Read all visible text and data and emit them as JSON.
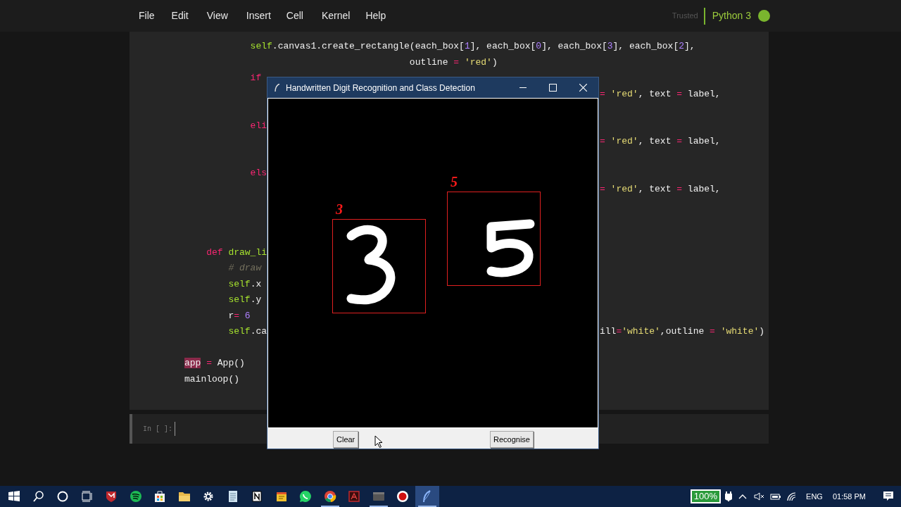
{
  "menu": [
    {
      "label": "File"
    },
    {
      "label": "Edit"
    },
    {
      "label": "View"
    },
    {
      "label": "Insert"
    },
    {
      "label": "Cell"
    },
    {
      "label": "Kernel"
    },
    {
      "label": "Help"
    }
  ],
  "kernel": {
    "trust": "Trusted",
    "name": "Python 3",
    "idle": true
  },
  "code_lines": [
    {
      "kind": "code",
      "left": [
        {
          "text": "            self",
          "kind": "self"
        },
        {
          "text": ".canvas1.create_rectangle(each_box[",
          "kind": "plain"
        },
        {
          "text": "1",
          "kind": "num"
        },
        {
          "text": "], each_box[",
          "kind": "plain"
        },
        {
          "text": "0",
          "kind": "num"
        },
        {
          "text": "], each_box[",
          "kind": "plain"
        },
        {
          "text": "3",
          "kind": "num"
        },
        {
          "text": "], each_box[",
          "kind": "plain"
        },
        {
          "text": "2",
          "kind": "num"
        },
        {
          "text": "],",
          "kind": "plain"
        }
      ]
    },
    {
      "kind": "code",
      "left": [
        {
          "text": "                                         outline",
          "kind": "plain"
        },
        {
          "text": " =",
          "kind": "op"
        },
        {
          "text": " 'red'",
          "kind": "str"
        },
        {
          "text": ")",
          "kind": "plain"
        }
      ]
    },
    {
      "kind": "code",
      "left": [
        {
          "text": "            if",
          "kind": "kw"
        }
      ]
    },
    {
      "kind": "code",
      "right": [
        {
          "text": "=",
          "kind": "op"
        },
        {
          "text": " 'red'",
          "kind": "str"
        },
        {
          "text": ", text",
          "kind": "plain"
        },
        {
          "text": " =",
          "kind": "op"
        },
        {
          "text": " label,",
          "kind": "plain"
        }
      ]
    },
    {
      "kind": "blank"
    },
    {
      "kind": "code",
      "left": [
        {
          "text": "            eli",
          "kind": "kw"
        }
      ]
    },
    {
      "kind": "code",
      "right": [
        {
          "text": "=",
          "kind": "op"
        },
        {
          "text": " 'red'",
          "kind": "str"
        },
        {
          "text": ", text",
          "kind": "plain"
        },
        {
          "text": " =",
          "kind": "op"
        },
        {
          "text": " label,",
          "kind": "plain"
        }
      ]
    },
    {
      "kind": "blank"
    },
    {
      "kind": "code",
      "left": [
        {
          "text": "            els",
          "kind": "kw"
        }
      ]
    },
    {
      "kind": "code",
      "right": [
        {
          "text": "=",
          "kind": "op"
        },
        {
          "text": " 'red'",
          "kind": "str"
        },
        {
          "text": ", text",
          "kind": "plain"
        },
        {
          "text": " =",
          "kind": "op"
        },
        {
          "text": " label,",
          "kind": "plain"
        }
      ]
    },
    {
      "kind": "blank"
    },
    {
      "kind": "blank"
    },
    {
      "kind": "blank"
    },
    {
      "kind": "code",
      "left": [
        {
          "text": "    def",
          "kind": "kw"
        },
        {
          "text": " draw_li",
          "kind": "fn"
        }
      ]
    },
    {
      "kind": "code",
      "left": [
        {
          "text": "        # draw",
          "kind": "comment"
        }
      ]
    },
    {
      "kind": "code",
      "left": [
        {
          "text": "        self",
          "kind": "self"
        },
        {
          "text": ".x",
          "kind": "plain"
        }
      ]
    },
    {
      "kind": "code",
      "left": [
        {
          "text": "        self",
          "kind": "self"
        },
        {
          "text": ".y",
          "kind": "plain"
        }
      ]
    },
    {
      "kind": "code",
      "left": [
        {
          "text": "        r",
          "kind": "plain"
        },
        {
          "text": "=",
          "kind": "op"
        },
        {
          "text": " 6",
          "kind": "num"
        }
      ]
    },
    {
      "kind": "code",
      "left": [
        {
          "text": "        self",
          "kind": "self"
        },
        {
          "text": ".ca",
          "kind": "plain"
        }
      ],
      "right": [
        {
          "text": "ill",
          "kind": "plain"
        },
        {
          "text": "=",
          "kind": "op"
        },
        {
          "text": "'white'",
          "kind": "str"
        },
        {
          "text": ",outline",
          "kind": "plain"
        },
        {
          "text": " =",
          "kind": "op"
        },
        {
          "text": " 'white'",
          "kind": "str"
        },
        {
          "text": ")",
          "kind": "plain"
        }
      ]
    },
    {
      "kind": "blank"
    },
    {
      "kind": "code",
      "left": [
        {
          "text": "app",
          "kind": "match"
        },
        {
          "text": " =",
          "kind": "op"
        },
        {
          "text": " App()",
          "kind": "plain"
        }
      ]
    },
    {
      "kind": "code",
      "left": [
        {
          "text": "mainloop()",
          "kind": "plain"
        }
      ]
    }
  ],
  "next_cell": {
    "prompt": "In [ ]:"
  },
  "app_window": {
    "title": "Handwritten Digit Recognition and Class Detection",
    "detections": [
      {
        "label": "3"
      },
      {
        "label": "5"
      }
    ],
    "buttons": [
      {
        "label": "Clear"
      },
      {
        "label": "Recognise"
      }
    ]
  },
  "taskbar": {
    "apps": [
      {
        "kind": "start",
        "active": false,
        "running": false
      },
      {
        "kind": "search",
        "active": false,
        "running": false
      },
      {
        "kind": "cortana",
        "active": false,
        "running": false
      },
      {
        "kind": "taskview",
        "active": false,
        "running": false
      },
      {
        "kind": "shield",
        "active": false,
        "running": false
      },
      {
        "kind": "music",
        "active": false,
        "running": false
      },
      {
        "kind": "store",
        "active": false,
        "running": false
      },
      {
        "kind": "folder",
        "active": false,
        "running": false
      },
      {
        "kind": "gear",
        "active": false,
        "running": false
      },
      {
        "kind": "notepad",
        "active": false,
        "running": false
      },
      {
        "kind": "notebook",
        "active": false,
        "running": false
      },
      {
        "kind": "sticky",
        "active": false,
        "running": false
      },
      {
        "kind": "chat",
        "active": false,
        "running": false
      },
      {
        "kind": "browser",
        "active": false,
        "running": true
      },
      {
        "kind": "pdf",
        "active": false,
        "running": false
      },
      {
        "kind": "window",
        "active": false,
        "running": true
      },
      {
        "kind": "record",
        "active": false,
        "running": false
      },
      {
        "kind": "feather",
        "active": true,
        "running": true
      }
    ],
    "battery": "100%",
    "language": "ENG",
    "time": "01:58 PM"
  }
}
